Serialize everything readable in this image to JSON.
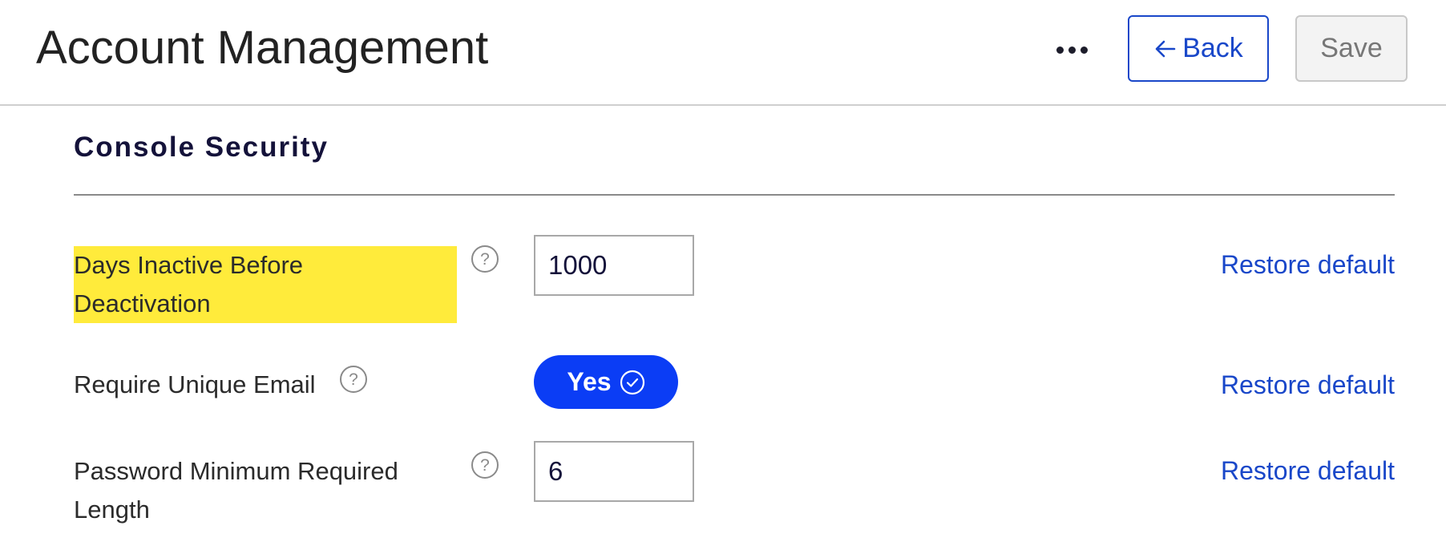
{
  "header": {
    "title": "Account Management",
    "more_icon": "more-horizontal-icon",
    "back_label": "Back",
    "back_icon": "arrow-left-icon",
    "save_label": "Save"
  },
  "section": {
    "title": "Console Security"
  },
  "settings": [
    {
      "label_line1": "Days Inactive Before",
      "label_line2": "Deactivation",
      "highlighted": true,
      "control": "number-input",
      "value": "1000",
      "restore_label": "Restore default"
    },
    {
      "label_line1": "Require Unique Email",
      "control": "toggle",
      "value": "Yes",
      "toggle_icon": "check-circle-icon",
      "restore_label": "Restore default"
    },
    {
      "label_line1": "Password Minimum Required",
      "label_line2": "Length",
      "control": "number-input",
      "value": "6",
      "restore_label": "Restore default"
    }
  ],
  "colors": {
    "accent": "#1947c9",
    "toggle_on": "#0b3df5",
    "highlight": "#ffeb3b"
  }
}
